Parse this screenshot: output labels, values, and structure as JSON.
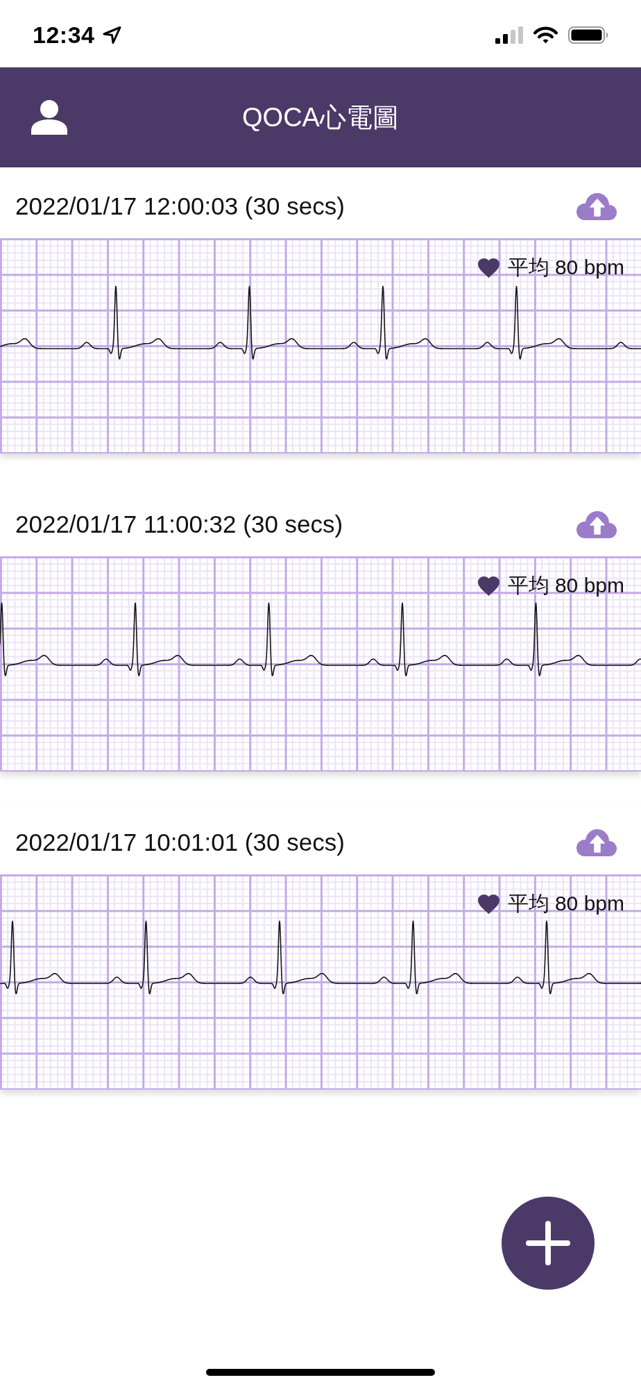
{
  "status_bar": {
    "time": "12:34"
  },
  "header": {
    "title": "QOCA心電圖"
  },
  "records": [
    {
      "timestamp": "2022/01/17 12:00:03 (30 secs)",
      "average_heart_rate": "平均 80 bpm"
    },
    {
      "timestamp": "2022/01/17 11:00:32 (30 secs)",
      "average_heart_rate": "平均 80 bpm"
    },
    {
      "timestamp": "2022/01/17 10:01:01 (30 secs)",
      "average_heart_rate": "平均 80 bpm"
    }
  ]
}
